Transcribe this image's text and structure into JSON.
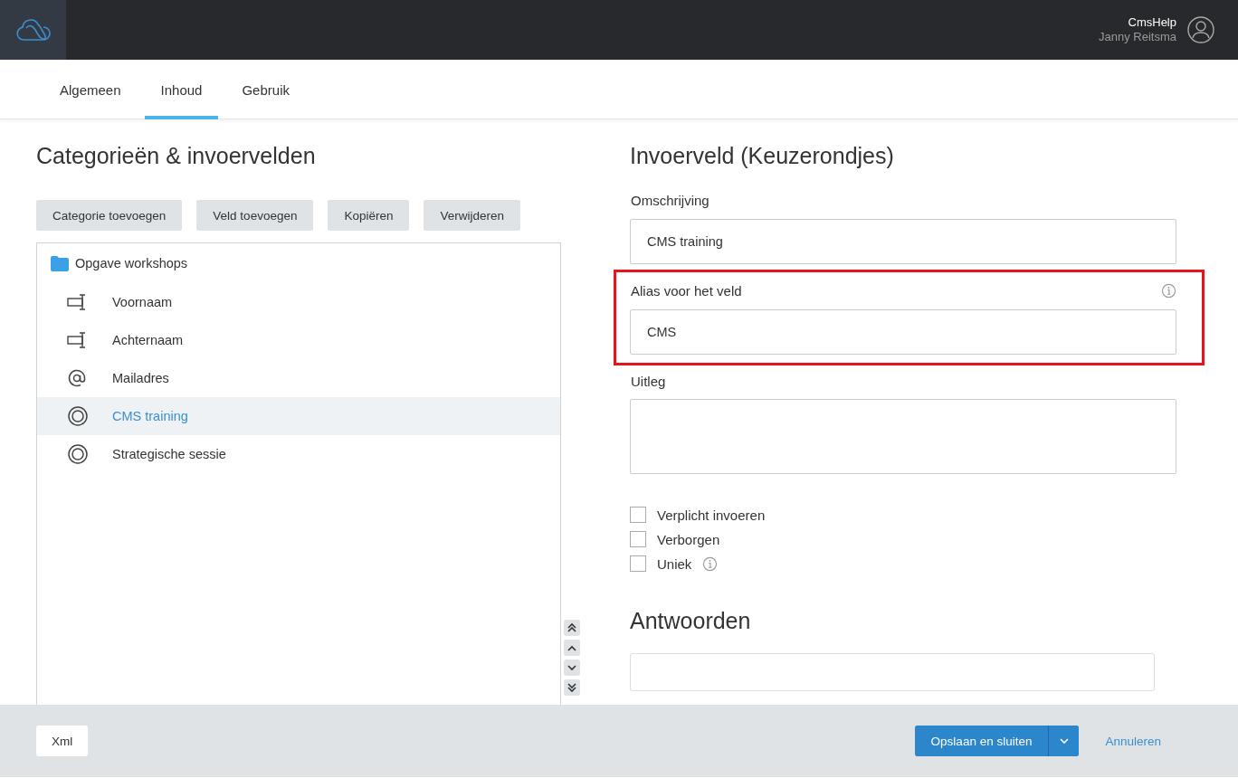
{
  "header": {
    "site": "CmsHelp",
    "user": "Janny Reitsma"
  },
  "tabs": [
    {
      "label": "Algemeen",
      "selected": false
    },
    {
      "label": "Inhoud",
      "selected": true
    },
    {
      "label": "Gebruik",
      "selected": false
    }
  ],
  "left": {
    "title": "Categorieën & invoervelden",
    "buttons": [
      "Categorie toevoegen",
      "Veld toevoegen",
      "Kopiëren",
      "Verwijderen"
    ],
    "tree": {
      "label": "Opgave workshops",
      "children": [
        {
          "label": "Voornaam",
          "kind": "text",
          "selected": false
        },
        {
          "label": "Achternaam",
          "kind": "text",
          "selected": false
        },
        {
          "label": "Mailadres",
          "kind": "email",
          "selected": false
        },
        {
          "label": "CMS training",
          "kind": "radio",
          "selected": true
        },
        {
          "label": "Strategische sessie",
          "kind": "radio",
          "selected": false
        }
      ]
    }
  },
  "right": {
    "title": "Invoerveld (Keuzerondjes)",
    "fields": [
      {
        "label": "Omschrijving",
        "value": "CMS training",
        "kind": "input",
        "info": false,
        "highlighted": false
      },
      {
        "label": "Alias voor het veld",
        "value": "CMS",
        "kind": "input",
        "info": true,
        "highlighted": true
      },
      {
        "label": "Uitleg",
        "kind": "textarea",
        "info": false,
        "highlighted": false
      }
    ],
    "checkboxes": [
      {
        "label": "Verplicht invoeren",
        "checked": false,
        "info": false
      },
      {
        "label": "Verborgen",
        "checked": false,
        "info": false
      },
      {
        "label": "Uniek",
        "checked": false,
        "info": true
      }
    ],
    "answers_title": "Antwoorden"
  },
  "footer": {
    "xml": "Xml",
    "save": "Opslaan en sluiten",
    "cancel": "Annuleren"
  }
}
